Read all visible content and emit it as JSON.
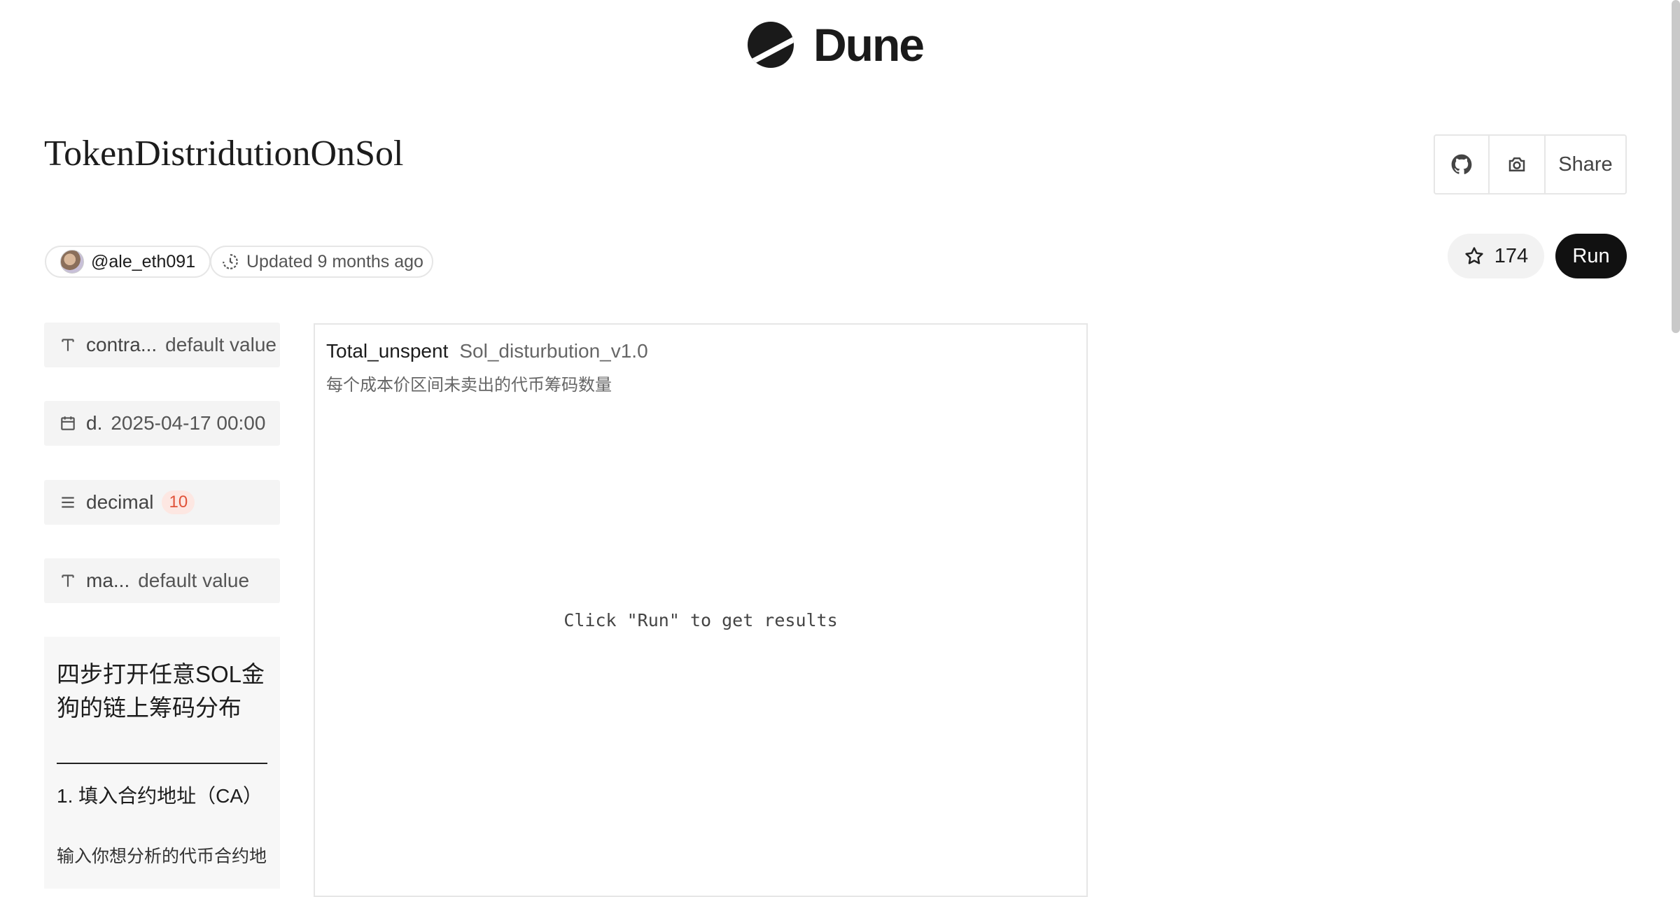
{
  "brand": {
    "name": "Dune"
  },
  "dashboard": {
    "title": "TokenDistridutionOnSol",
    "author": "@ale_eth091",
    "updated": "Updated 9 months ago",
    "stars": "174"
  },
  "actions": {
    "share_label": "Share",
    "run_label": "Run"
  },
  "parameters": [
    {
      "icon": "text-icon",
      "name": "contra...",
      "value": "default value"
    },
    {
      "icon": "calendar-icon",
      "name": "d.",
      "value": "2025-04-17 00:00"
    },
    {
      "icon": "list-icon",
      "name": "decimal",
      "value": "10"
    },
    {
      "icon": "text-icon",
      "name": "ma...",
      "value": "default value"
    }
  ],
  "text_widget": {
    "heading": "四步打开任意SOL金狗的链上筹码分布",
    "step1": "1. 填入合约地址（CA）",
    "body": "输入你想分析的代币合约地"
  },
  "chart_panel": {
    "query_name": "Total_unspent",
    "viz_name": "Sol_disturbution_v1.0",
    "description": "每个成本价区间未卖出的代币筹码数量",
    "empty_message": "Click \"Run\" to get results"
  }
}
